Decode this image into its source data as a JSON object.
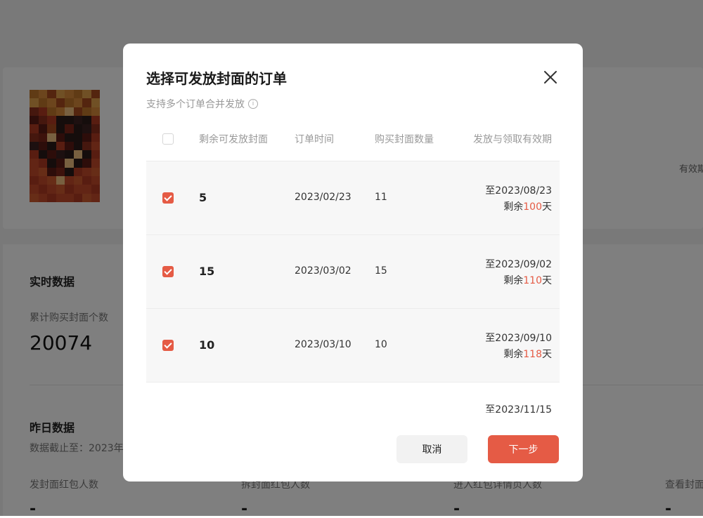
{
  "background": {
    "valid_label": "有效期",
    "realtime": {
      "title": "实时数据",
      "metric_label": "累计购买封面个数",
      "metric_value": "20074"
    },
    "yesterday": {
      "title": "昨日数据",
      "cutoff": "数据截止至：2023年",
      "metrics": [
        {
          "label": "发封面红包人数",
          "value": "-"
        },
        {
          "label": "拆封面红包人数",
          "value": "-"
        },
        {
          "label": "进入红包详情页人数",
          "value": "-"
        },
        {
          "label": "查看封面",
          "value": "-"
        }
      ]
    }
  },
  "modal": {
    "title": "选择可发放封面的订单",
    "subtitle": "支持多个订单合并发放",
    "info_icon": "i",
    "columns": [
      "剩余可发放封面",
      "订单时间",
      "购买封面数量",
      "发放与领取有效期"
    ],
    "rows": [
      {
        "checked": true,
        "remaining": "5",
        "order_date": "2023/02/23",
        "quantity": "11",
        "valid_until": "至2023/08/23",
        "left_prefix": "剩余",
        "left_days": "100",
        "left_suffix": "天"
      },
      {
        "checked": true,
        "remaining": "15",
        "order_date": "2023/03/02",
        "quantity": "15",
        "valid_until": "至2023/09/02",
        "left_prefix": "剩余",
        "left_days": "110",
        "left_suffix": "天"
      },
      {
        "checked": true,
        "remaining": "10",
        "order_date": "2023/03/10",
        "quantity": "10",
        "valid_until": "至2023/09/10",
        "left_prefix": "剩余",
        "left_days": "118",
        "left_suffix": "天"
      },
      {
        "checked": false,
        "remaining": "",
        "order_date": "",
        "quantity": "",
        "valid_until": "至2023/11/15",
        "left_prefix": "",
        "left_days": "",
        "left_suffix": ""
      }
    ],
    "cancel_label": "取消",
    "next_label": "下一步",
    "accent_color": "#e55b45"
  }
}
